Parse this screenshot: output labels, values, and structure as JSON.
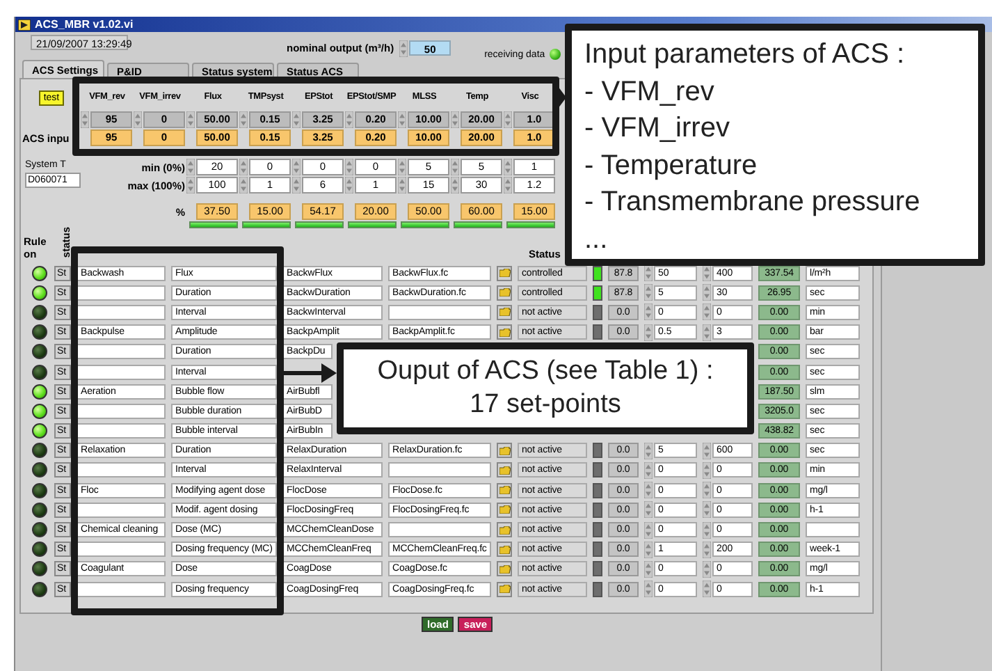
{
  "window": {
    "title": "ACS_MBR v1.02.vi"
  },
  "timestamp": "21/09/2007 13:29:49",
  "nominal_output": {
    "label": "nominal output (m³/h)",
    "value": "50"
  },
  "receiving_data": {
    "label": "receiving data",
    "on": true
  },
  "tabs": [
    {
      "label": "ACS Settings",
      "selected": true
    },
    {
      "label": "P&ID",
      "selected": false
    },
    {
      "label": "Status system",
      "selected": false
    },
    {
      "label": "Status ACS",
      "selected": false
    }
  ],
  "test_button": "test",
  "inputs": {
    "row_label": "ACS inpu",
    "min_label": "min (0%)",
    "max_label": "max (100%)",
    "percent_label": "%",
    "columns": [
      {
        "label": "VFM_rev",
        "value": "95",
        "input": "95"
      },
      {
        "label": "VFM_irrev",
        "value": "0",
        "input": "0"
      },
      {
        "label": "Flux",
        "value": "50.00",
        "input": "50.00",
        "min": "20",
        "max": "100",
        "percent": "37.50"
      },
      {
        "label": "TMPsyst",
        "value": "0.15",
        "input": "0.15",
        "min": "0",
        "max": "1",
        "percent": "15.00"
      },
      {
        "label": "EPStot",
        "value": "3.25",
        "input": "3.25",
        "min": "0",
        "max": "6",
        "percent": "54.17"
      },
      {
        "label": "EPStot/SMP",
        "value": "0.20",
        "input": "0.20",
        "min": "0",
        "max": "1",
        "percent": "20.00"
      },
      {
        "label": "MLSS",
        "value": "10.00",
        "input": "10.00",
        "min": "5",
        "max": "15",
        "percent": "50.00"
      },
      {
        "label": "Temp",
        "value": "20.00",
        "input": "20.00",
        "min": "5",
        "max": "30",
        "percent": "60.00"
      },
      {
        "label": "Visc",
        "value": "1.0",
        "input": "1.0",
        "min": "1",
        "max": "1.2",
        "percent": "15.00"
      }
    ]
  },
  "system": {
    "label": "System T",
    "value": "D060071"
  },
  "table": {
    "rule_header": "Rule on",
    "status_vertical": "status",
    "status_header": "Status",
    "rows": [
      {
        "kind": "full",
        "rule_on": true,
        "button": "St",
        "group": "Backwash",
        "parameter": "Flux",
        "variable": "BackwFlux",
        "file": "BackwFlux.fc",
        "status": "controlled",
        "active": true,
        "actual": "87.8",
        "low": "50",
        "high": "400",
        "setpoint": "337.54",
        "unit": "l/m²h"
      },
      {
        "kind": "full",
        "rule_on": true,
        "button": "St",
        "parameter": "Duration",
        "variable": "BackwDuration",
        "file": "BackwDuration.fc",
        "status": "controlled",
        "active": true,
        "actual": "87.8",
        "low": "5",
        "high": "30",
        "setpoint": "26.95",
        "unit": "sec"
      },
      {
        "kind": "full",
        "rule_on": false,
        "button": "St",
        "parameter": "Interval",
        "variable": "BackwInterval",
        "status": "not active",
        "active": false,
        "actual": "0.0",
        "low": "0",
        "high": "0",
        "setpoint": "0.00",
        "unit": "min"
      },
      {
        "kind": "full",
        "rule_on": false,
        "button": "St",
        "group": "Backpulse",
        "parameter": "Amplitude",
        "variable": "BackpAmplit",
        "file": "BackpAmplit.fc",
        "status": "not active",
        "active": false,
        "actual": "0.0",
        "low": "0.5",
        "high": "3",
        "setpoint": "0.00",
        "unit": "bar"
      },
      {
        "kind": "covered",
        "rule_on": false,
        "button": "St",
        "parameter": "Duration",
        "variable": "BackpDu",
        "setpoint": "0.00",
        "unit": "sec"
      },
      {
        "kind": "covered",
        "rule_on": false,
        "button": "St",
        "parameter": "Interval",
        "setpoint": "0.00",
        "unit": "sec"
      },
      {
        "kind": "covered",
        "rule_on": true,
        "button": "St",
        "group": "Aeration",
        "parameter": "Bubble flow",
        "variable": "AirBubfl",
        "setpoint": "187.50",
        "unit": "slm"
      },
      {
        "kind": "covered",
        "rule_on": true,
        "button": "St",
        "parameter": "Bubble duration",
        "variable": "AirBubD",
        "setpoint": "3205.0",
        "unit": "sec"
      },
      {
        "kind": "covered",
        "rule_on": true,
        "button": "St",
        "parameter": "Bubble interval",
        "variable": "AirBubIn",
        "setpoint": "438.82",
        "unit": "sec"
      },
      {
        "kind": "full",
        "rule_on": false,
        "button": "St",
        "group": "Relaxation",
        "parameter": "Duration",
        "variable": "RelaxDuration",
        "file": "RelaxDuration.fc",
        "status": "not active",
        "active": false,
        "actual": "0.0",
        "low": "5",
        "high": "600",
        "setpoint": "0.00",
        "unit": "sec"
      },
      {
        "kind": "full",
        "rule_on": false,
        "button": "St",
        "parameter": "Interval",
        "variable": "RelaxInterval",
        "status": "not active",
        "active": false,
        "actual": "0.0",
        "low": "0",
        "high": "0",
        "setpoint": "0.00",
        "unit": "min"
      },
      {
        "kind": "full",
        "rule_on": false,
        "button": "St",
        "group": "Floc",
        "parameter": "Modifying agent dose",
        "variable": "FlocDose",
        "file": "FlocDose.fc",
        "status": "not active",
        "active": false,
        "actual": "0.0",
        "low": "0",
        "high": "0",
        "setpoint": "0.00",
        "unit": "mg/l"
      },
      {
        "kind": "full",
        "rule_on": false,
        "button": "St",
        "parameter": "Modif. agent dosing",
        "variable": "FlocDosingFreq",
        "file": "FlocDosingFreq.fc",
        "status": "not active",
        "active": false,
        "actual": "0.0",
        "low": "0",
        "high": "0",
        "setpoint": "0.00",
        "unit": "h-1"
      },
      {
        "kind": "full",
        "rule_on": false,
        "button": "St",
        "group": "Chemical cleaning",
        "parameter": "Dose (MC)",
        "variable": "MCChemCleanDose",
        "status": "not active",
        "active": false,
        "actual": "0.0",
        "low": "0",
        "high": "0",
        "setpoint": "0.00"
      },
      {
        "kind": "full",
        "rule_on": false,
        "button": "St",
        "parameter": "Dosing frequency (MC)",
        "variable": "MCChemCleanFreq",
        "file": "MCChemCleanFreq.fc",
        "status": "not active",
        "active": false,
        "actual": "0.0",
        "low": "1",
        "high": "200",
        "setpoint": "0.00",
        "unit": "week-1"
      },
      {
        "kind": "full",
        "rule_on": false,
        "button": "St",
        "group": "Coagulant",
        "parameter": "Dose",
        "variable": "CoagDose",
        "file": "CoagDose.fc",
        "status": "not active",
        "active": false,
        "actual": "0.0",
        "low": "0",
        "high": "0",
        "setpoint": "0.00",
        "unit": "mg/l"
      },
      {
        "kind": "full",
        "rule_on": false,
        "button": "St",
        "parameter": "Dosing frequency",
        "variable": "CoagDosingFreq",
        "file": "CoagDosingFreq.fc",
        "status": "not active",
        "active": false,
        "actual": "0.0",
        "low": "0",
        "high": "0",
        "setpoint": "0.00",
        "unit": "h-1"
      }
    ]
  },
  "buttons": [
    {
      "kind": "load",
      "label": "load"
    },
    {
      "kind": "save",
      "label": "save"
    }
  ],
  "callouts": [
    {
      "kind": "input",
      "lines": [
        "Input parameters of ACS :",
        "- VFM_rev",
        "- VFM_irrev",
        "- Temperature",
        "- Transmembrane pressure",
        "..."
      ]
    },
    {
      "kind": "output",
      "lines": [
        "Ouput of ACS (see Table 1) :",
        "17 set-points"
      ]
    }
  ]
}
